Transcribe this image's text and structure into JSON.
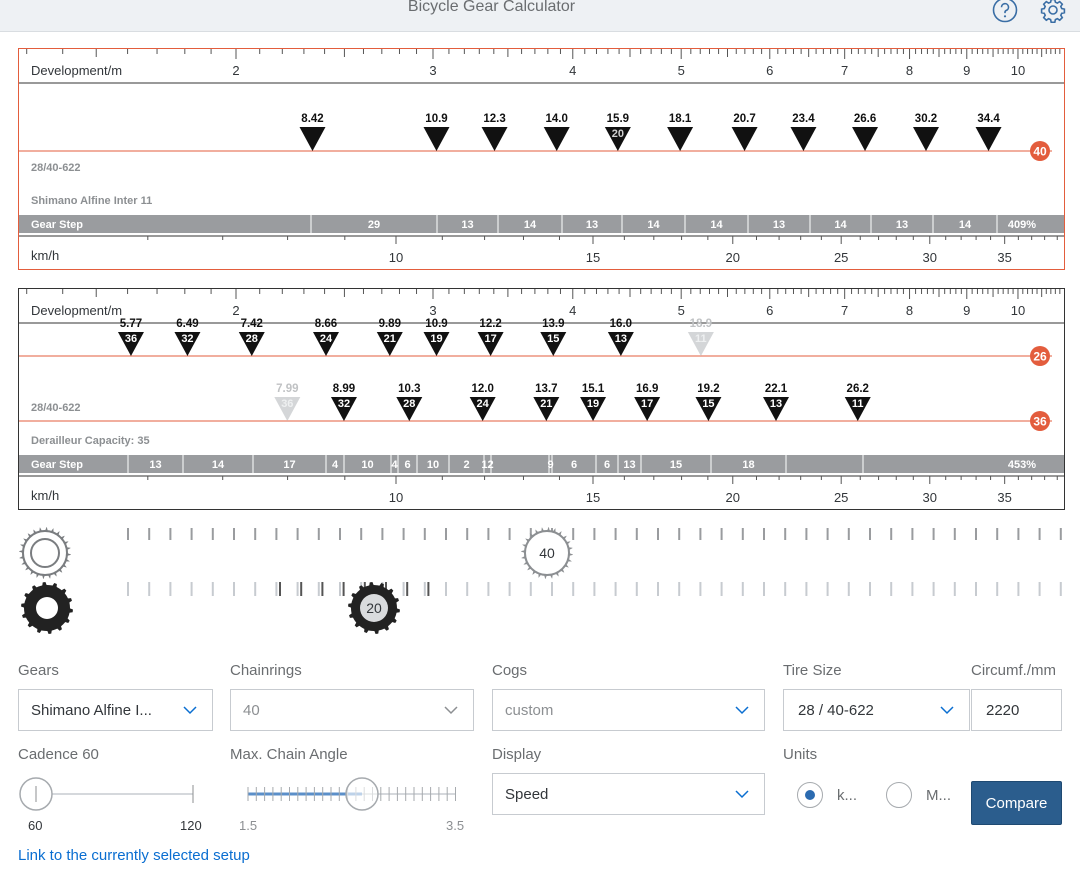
{
  "app": {
    "title": "Bicycle Gear Calculator"
  },
  "header": {
    "help_icon": "question-circle-icon",
    "settings_icon": "gear-icon"
  },
  "chart_data": [
    {
      "type": "other",
      "development_label": "Development/m",
      "development_ticks": [
        "2",
        "3",
        "4",
        "5",
        "6",
        "7",
        "8",
        "9",
        "10"
      ],
      "kmh_label": "km/h",
      "kmh_ticks": [
        "10",
        "15",
        "20",
        "25",
        "30",
        "35"
      ],
      "tire_label": "28/40-622",
      "system_label": "Shimano Alfine Inter 11",
      "gear_step_label": "Gear Step",
      "chainrings": [
        {
          "teeth": "40",
          "gears": [
            {
              "development": "8.42",
              "cog": ""
            },
            {
              "development": "10.9",
              "cog": ""
            },
            {
              "development": "12.3",
              "cog": ""
            },
            {
              "development": "14.0",
              "cog": ""
            },
            {
              "development": "15.9",
              "cog": "20",
              "selected": true
            },
            {
              "development": "18.1",
              "cog": ""
            },
            {
              "development": "20.7",
              "cog": ""
            },
            {
              "development": "23.4",
              "cog": ""
            },
            {
              "development": "26.6",
              "cog": ""
            },
            {
              "development": "30.2",
              "cog": ""
            },
            {
              "development": "34.4",
              "cog": ""
            }
          ]
        }
      ],
      "gear_steps": [
        "29",
        "13",
        "14",
        "13",
        "14",
        "14",
        "13",
        "14",
        "13",
        "14"
      ],
      "total_range": "409%"
    },
    {
      "type": "other",
      "development_label": "Development/m",
      "development_ticks": [
        "2",
        "3",
        "4",
        "5",
        "6",
        "7",
        "8",
        "9",
        "10"
      ],
      "kmh_label": "km/h",
      "kmh_ticks": [
        "10",
        "15",
        "20",
        "25",
        "30",
        "35"
      ],
      "tire_label": "28/40-622",
      "system_label": "Derailleur Capacity: 35",
      "gear_step_label": "Gear Step",
      "chainrings": [
        {
          "teeth": "26",
          "gears": [
            {
              "development": "5.77",
              "cog": "36"
            },
            {
              "development": "6.49",
              "cog": "32"
            },
            {
              "development": "7.42",
              "cog": "28"
            },
            {
              "development": "8.66",
              "cog": "24"
            },
            {
              "development": "9.89",
              "cog": "21"
            },
            {
              "development": "10.9",
              "cog": "19"
            },
            {
              "development": "12.2",
              "cog": "17"
            },
            {
              "development": "13.9",
              "cog": "15"
            },
            {
              "development": "16.0",
              "cog": "13"
            },
            {
              "development": "18.9",
              "cog": "11",
              "disabled": true
            }
          ]
        },
        {
          "teeth": "36",
          "gears": [
            {
              "development": "7.99",
              "cog": "36",
              "disabled": true
            },
            {
              "development": "8.99",
              "cog": "32"
            },
            {
              "development": "10.3",
              "cog": "28"
            },
            {
              "development": "12.0",
              "cog": "24"
            },
            {
              "development": "13.7",
              "cog": "21"
            },
            {
              "development": "15.1",
              "cog": "19"
            },
            {
              "development": "16.9",
              "cog": "17"
            },
            {
              "development": "19.2",
              "cog": "15"
            },
            {
              "development": "22.1",
              "cog": "13"
            },
            {
              "development": "26.2",
              "cog": "11"
            }
          ]
        }
      ],
      "gear_steps": [
        "13",
        "14",
        "17",
        "4",
        "10",
        "4",
        "6",
        "10",
        "2",
        "12",
        "",
        "9",
        "6",
        "6",
        "13",
        "15",
        "18"
      ],
      "total_range": "453%"
    }
  ],
  "gear_sliders": {
    "chainring_value": "40",
    "cog_value": "20",
    "chainring_icon": "chainring-icon",
    "cog_icon": "cog-icon"
  },
  "form": {
    "gears": {
      "label": "Gears",
      "value": "Shimano Alfine I..."
    },
    "chainrings": {
      "label": "Chainrings",
      "value": "40"
    },
    "cogs": {
      "label": "Cogs",
      "value": "custom"
    },
    "tire_size": {
      "label": "Tire Size",
      "value": "28 / 40-622"
    },
    "circumference": {
      "label": "Circumf./mm",
      "value": "2220"
    },
    "cadence": {
      "label": "Cadence 60",
      "min": "60",
      "max": "120",
      "value": 60
    },
    "chain_angle": {
      "label": "Max. Chain Angle",
      "min": "1.5",
      "max": "3.5",
      "value": 2.5
    },
    "display": {
      "label": "Display",
      "value": "Speed"
    },
    "units": {
      "label": "Units",
      "options": [
        "k...",
        "M..."
      ],
      "selected": 0
    },
    "compare_label": "Compare",
    "link_label": "Link to the currently selected setup"
  },
  "colors": {
    "accent": "#e35d3d",
    "primary": "#2b5d8d",
    "link": "#0a6ed1"
  }
}
